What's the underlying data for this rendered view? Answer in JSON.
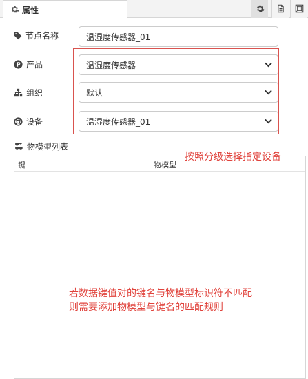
{
  "panel": {
    "tab_label": "属性",
    "tab_icon": "gear-icon",
    "toolbar": [
      {
        "name": "settings-button",
        "icon": "gear-icon"
      },
      {
        "name": "description-button",
        "icon": "document-icon"
      },
      {
        "name": "appearance-button",
        "icon": "frame-icon"
      }
    ]
  },
  "form": {
    "node_name": {
      "label": "节点名称",
      "icon": "tag-icon",
      "value": "温湿度传感器_01"
    },
    "product": {
      "label": "产品",
      "icon": "product-p-icon",
      "value": "温湿度传感器"
    },
    "group": {
      "label": "组织",
      "icon": "org-chart-icon",
      "value": "默认"
    },
    "device": {
      "label": "设备",
      "icon": "lifebuoy-icon",
      "value": "温湿度传感器_01"
    }
  },
  "model_list": {
    "label": "物模型列表",
    "icon": "cubes-icon",
    "columns": [
      "键",
      "物模型"
    ]
  },
  "annotations": {
    "hierarchy_note": "按照分级选择指定设备",
    "mapping_note_line1": "若数据键值对的键名与物模型标识符不匹配",
    "mapping_note_line2": "则需要添加物模型与键名的匹配规则"
  },
  "colors": {
    "annotation_red": "#e0423b",
    "highlight_border": "#d9534f"
  }
}
